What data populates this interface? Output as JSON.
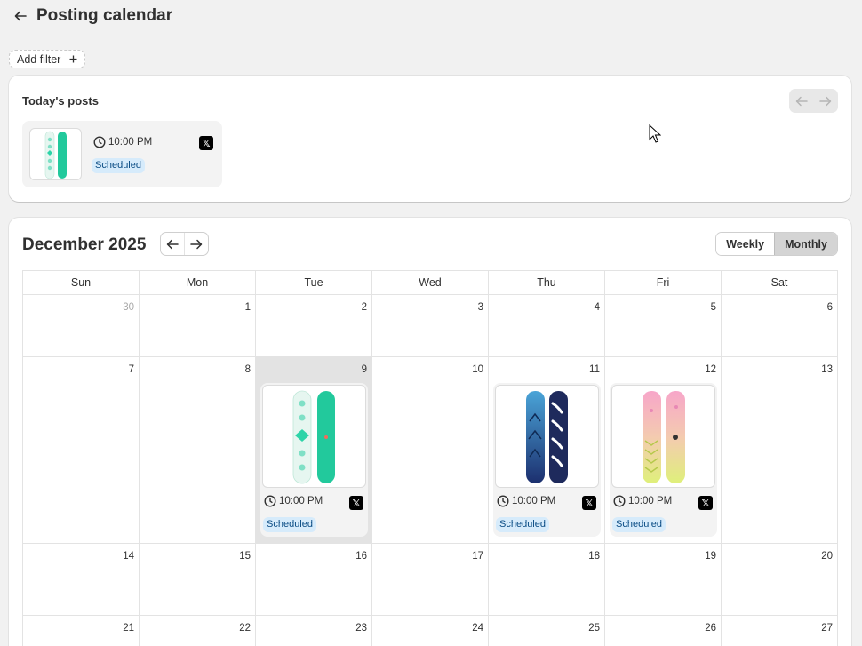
{
  "header": {
    "title": "Posting calendar",
    "back_icon": "arrow-left-icon"
  },
  "filter": {
    "label": "Add filter",
    "icon": "plus"
  },
  "today": {
    "title": "Today's posts",
    "post": {
      "time": "10:00 PM",
      "platform": "X",
      "status": "Scheduled"
    }
  },
  "calendar": {
    "month_label": "December 2025",
    "views": {
      "weekly": "Weekly",
      "monthly": "Monthly",
      "selected": "Monthly"
    },
    "weekdays": [
      "Sun",
      "Mon",
      "Tue",
      "Wed",
      "Thu",
      "Fri",
      "Sat"
    ],
    "weeks": [
      [
        "30",
        "1",
        "2",
        "3",
        "4",
        "5",
        "6"
      ],
      [
        "7",
        "8",
        "9",
        "10",
        "11",
        "12",
        "13"
      ],
      [
        "14",
        "15",
        "16",
        "17",
        "18",
        "19",
        "20"
      ],
      [
        "21",
        "22",
        "23",
        "24",
        "25",
        "26",
        "27"
      ]
    ],
    "today_date": "9",
    "posts": {
      "tue": {
        "time": "10:00 PM",
        "platform": "X",
        "status": "Scheduled"
      },
      "thu": {
        "time": "10:00 PM",
        "platform": "X",
        "status": "Scheduled"
      },
      "fri": {
        "time": "10:00 PM",
        "platform": "X",
        "status": "Scheduled"
      }
    }
  },
  "colors": {
    "accent_status_bg": "#d6ebfb",
    "accent_status_text": "#0a4c84",
    "page_bg": "#f1f1f1"
  }
}
